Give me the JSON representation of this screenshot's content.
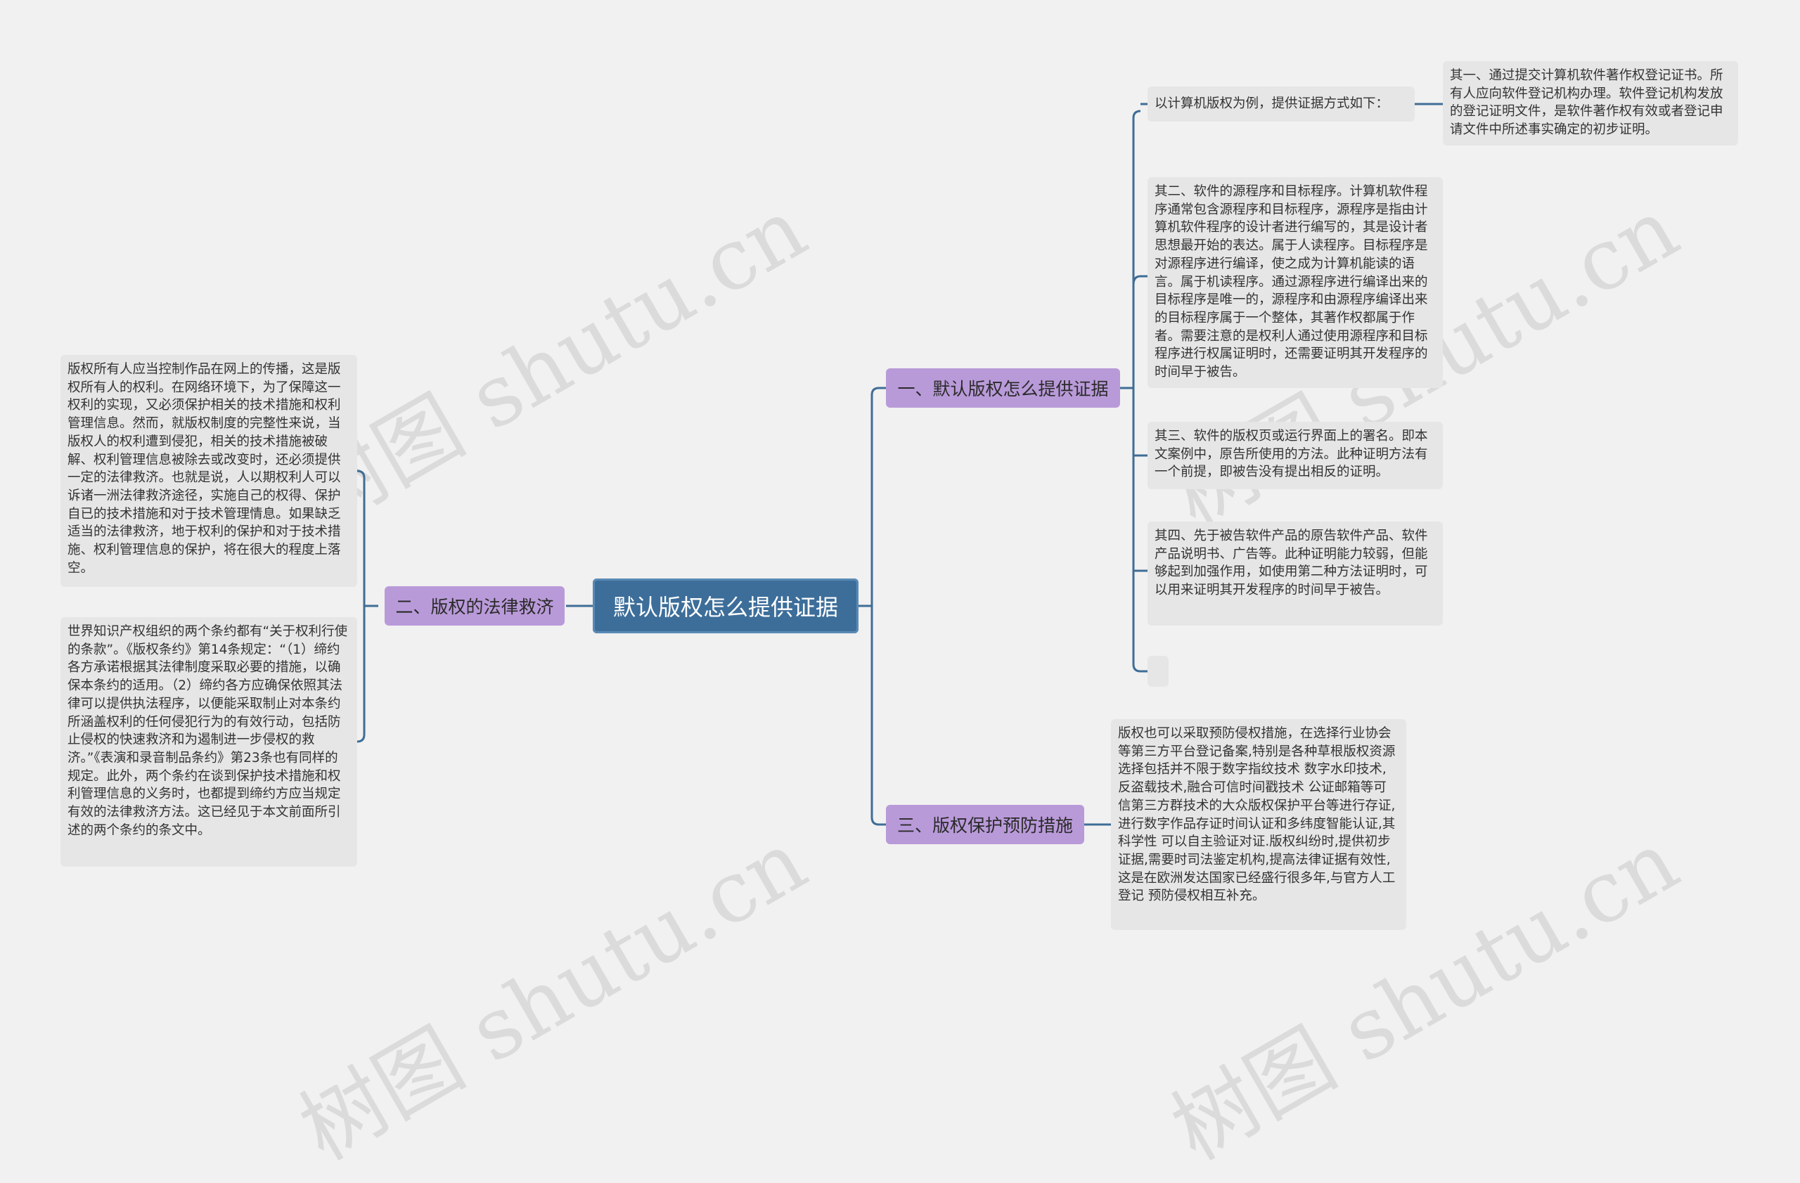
{
  "watermark": "树图 shutu.cn",
  "root": {
    "label": "默认版权怎么提供证据"
  },
  "branches": {
    "b1": {
      "label": "一、默认版权怎么提供证据"
    },
    "b2": {
      "label": "二、版权的法律救济"
    },
    "b3": {
      "label": "三、版权保护预防措施"
    }
  },
  "leaves": {
    "intro": "以计算机版权为例，提供证据方式如下：",
    "first": "其一、通过提交计算机软件著作权登记证书。所有人应向软件登记机构办理。软件登记机构发放的登记证明文件，是软件著作权有效或者登记申请文件中所述事实确定的初步证明。",
    "second": "其二、软件的源程序和目标程序。计算机软件程序通常包含源程序和目标程序，源程序是指由计算机软件程序的设计者进行编写的，其是设计者思想最开始的表达。属于人读程序。目标程序是对源程序进行编译，使之成为计算机能读的语言。属于机读程序。通过源程序进行编译出来的目标程序是唯一的，源程序和由源程序编译出来的目标程序属于一个整体，其著作权都属于作者。需要注意的是权利人通过使用源程序和目标程序进行权属证明时，还需要证明其开发程序的时间早于被告。",
    "third": "其三、软件的版权页或运行界面上的署名。即本文案例中，原告所使用的方法。此种证明方法有一个前提，即被告没有提出相反的证明。",
    "fourth": "其四、先于被告软件产品的原告软件产品、软件产品说明书、广告等。此种证明能力较弱，但能够起到加强作用，如使用第二种方法证明时，可以用来证明其开发程序的时间早于被告。",
    "empty": "",
    "remedy1": "版权所有人应当控制作品在网上的传播，这是版权所有人的权利。在网络环境下，为了保障这一权利的实现，又必须保护相关的技术措施和权利管理信息。然而，就版权制度的完整性来说，当版权人的权利遭到侵犯，相关的技术措施被破解、权利管理信息被除去或改变时，还必须提供一定的法律救济。也就是说，人以期权利人可以诉诸一洲法律救济途径，实施自己的权得、保护自已的技术措施和对于技术管理情息。如果缺乏适当的法律救济，地于权利的保护和对于技术措施、权利管理信息的保护，将在很大的程度上落空。",
    "remedy2": "世界知识产权组织的两个条约都有“关于权利行使的条款”。《版权条约》第14条规定：“（1）缔约各方承诺根据其法律制度采取必要的措施，以确保本条约的适用。（2）缔约各方应确保依照其法律可以提供执法程序，以便能采取制止对本条约所涵盖权利的任何侵犯行为的有效行动，包括防止侵权的快速救济和为遏制进一步侵权的救济。”《表演和录音制品条约》第23条也有同样的规定。此外，两个条约在谈到保护技术措施和权利管理信息的义务时，也都提到缔约方应当规定有效的法律救济方法。这已经见于本文前面所引述的两个条约的条文中。",
    "prevent": "版权也可以采取预防侵权措施，在选择行业协会等第三方平台登记备案,特别是各种草根版权资源选择包括并不限于数字指纹技术 数字水印技术,反盗载技术,融合可信时间戳技术 公证邮箱等可信第三方群技术的大众版权保护平台等进行存证,进行数字作品存证时间认证和多纬度智能认证,其科学性 可以自主验证对证.版权纠纷时,提供初步证据,需要时司法鉴定机构,提高法律证据有效性,这是在欧洲发达国家已经盛行很多年,与官方人工登记 预防侵权相互补充。"
  },
  "colors": {
    "root": "#3d6e9a",
    "branch": "#b99ad9",
    "leaf": "#e6e6e6",
    "line": "#3f6d96"
  }
}
